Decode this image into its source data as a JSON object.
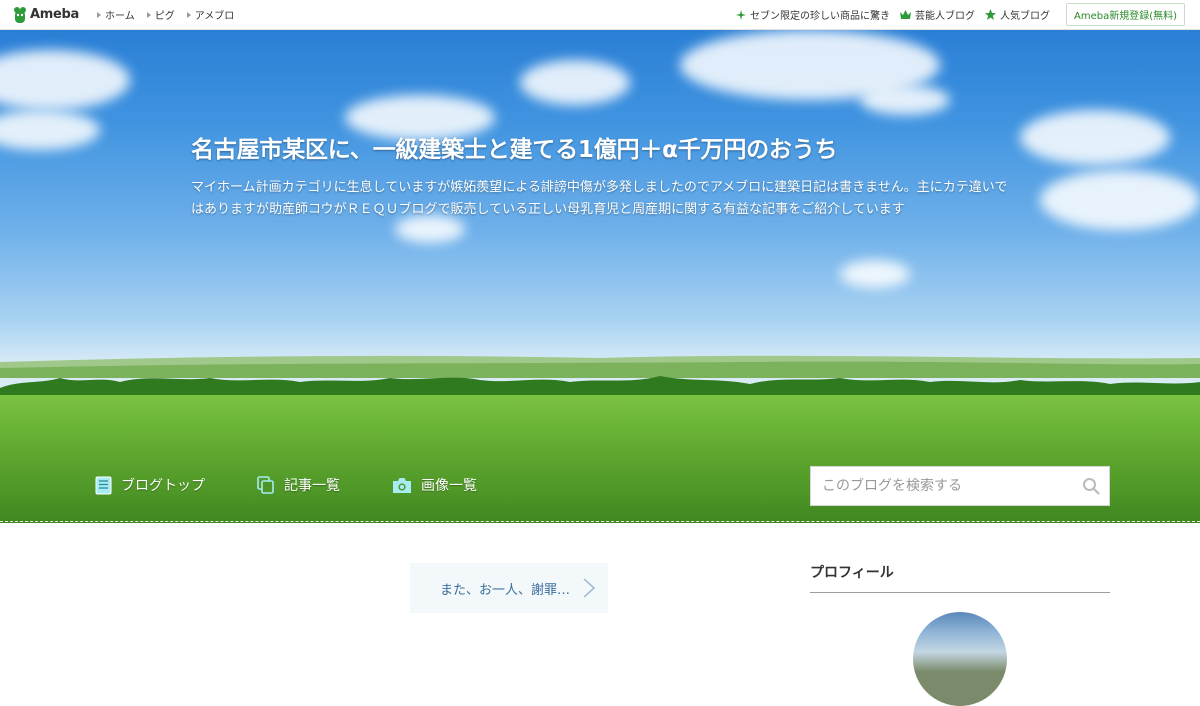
{
  "topbar": {
    "logo_text": "Ameba",
    "nav": [
      "ホーム",
      "ピグ",
      "アメブロ"
    ],
    "links": [
      {
        "label": "セブン限定の珍しい商品に驚き",
        "icon": "sparkle-icon"
      },
      {
        "label": "芸能人ブログ",
        "icon": "crown-icon"
      },
      {
        "label": "人気ブログ",
        "icon": "star-icon"
      }
    ],
    "signup_label": "Ameba新規登録(無料)"
  },
  "header": {
    "title": "名古屋市某区に、一級建築士と建てる1億円＋α千万円のおうち",
    "description": "マイホーム計画カテゴリに生息していますが嫉妬羨望による誹謗中傷が多発しましたのでアメブロに建築日記は書きません。主にカテ違いではありますが助産師コウがＲＥＱＵブログで販売している正しい母乳育児と周産期に関する有益な記事をご紹介しています"
  },
  "blognav": {
    "items": [
      {
        "label": "ブログトップ",
        "icon": "document-icon"
      },
      {
        "label": "記事一覧",
        "icon": "copy-icon"
      },
      {
        "label": "画像一覧",
        "icon": "camera-icon"
      }
    ],
    "search_placeholder": "このブログを検索する"
  },
  "main": {
    "prev_article_label": "また、お一人、謝罪…"
  },
  "sidebar": {
    "profile_heading": "プロフィール"
  },
  "colors": {
    "accent_green": "#2a8a2a",
    "link_blue": "#3a6e9a"
  }
}
